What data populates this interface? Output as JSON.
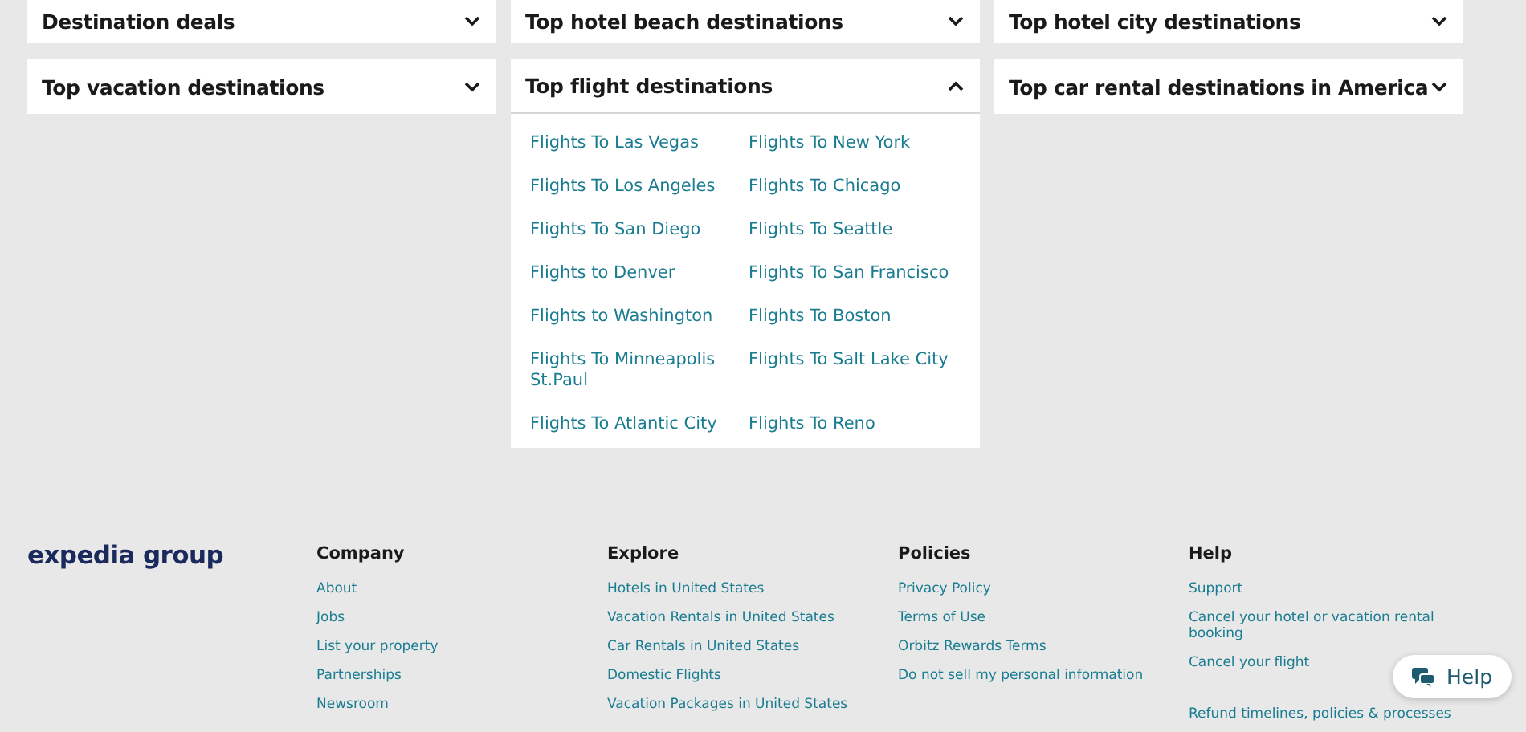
{
  "sections": [
    {
      "title": "Destination deals",
      "expanded": false
    },
    {
      "title": "Top hotel beach destinations",
      "expanded": false
    },
    {
      "title": "Top hotel city destinations",
      "expanded": false
    },
    {
      "title": "Top vacation destinations",
      "expanded": false
    },
    {
      "title": "Top flight destinations",
      "expanded": true,
      "links": [
        "Flights To Las Vegas",
        "Flights To New York",
        "Flights To Los Angeles",
        "Flights To Chicago",
        "Flights To San Diego",
        "Flights To Seattle",
        "Flights to Denver",
        "Flights To San Francisco",
        "Flights to Washington",
        "Flights To Boston",
        "Flights To Minneapolis St.Paul",
        "Flights To Salt Lake City",
        "Flights To Atlantic City",
        "Flights To Reno"
      ]
    },
    {
      "title": "Top car rental destinations in America",
      "expanded": false
    }
  ],
  "footer": {
    "logo": "expedia group",
    "columns": [
      {
        "heading": "Company",
        "links": [
          "About",
          "Jobs",
          "List your property",
          "Partnerships",
          "Newsroom"
        ]
      },
      {
        "heading": "Explore",
        "links": [
          "Hotels in United States",
          "Vacation Rentals in United States",
          "Car Rentals in United States",
          "Domestic Flights",
          "Vacation Packages in United States"
        ]
      },
      {
        "heading": "Policies",
        "links": [
          "Privacy Policy",
          "Terms of Use",
          "Orbitz Rewards Terms",
          "Do not sell my personal information"
        ]
      },
      {
        "heading": "Help",
        "links": [
          "Support",
          "Cancel your hotel or vacation rental booking",
          "Cancel your flight",
          "Refund timelines, policies & processes"
        ]
      }
    ]
  },
  "help_button": {
    "label": "Help"
  }
}
